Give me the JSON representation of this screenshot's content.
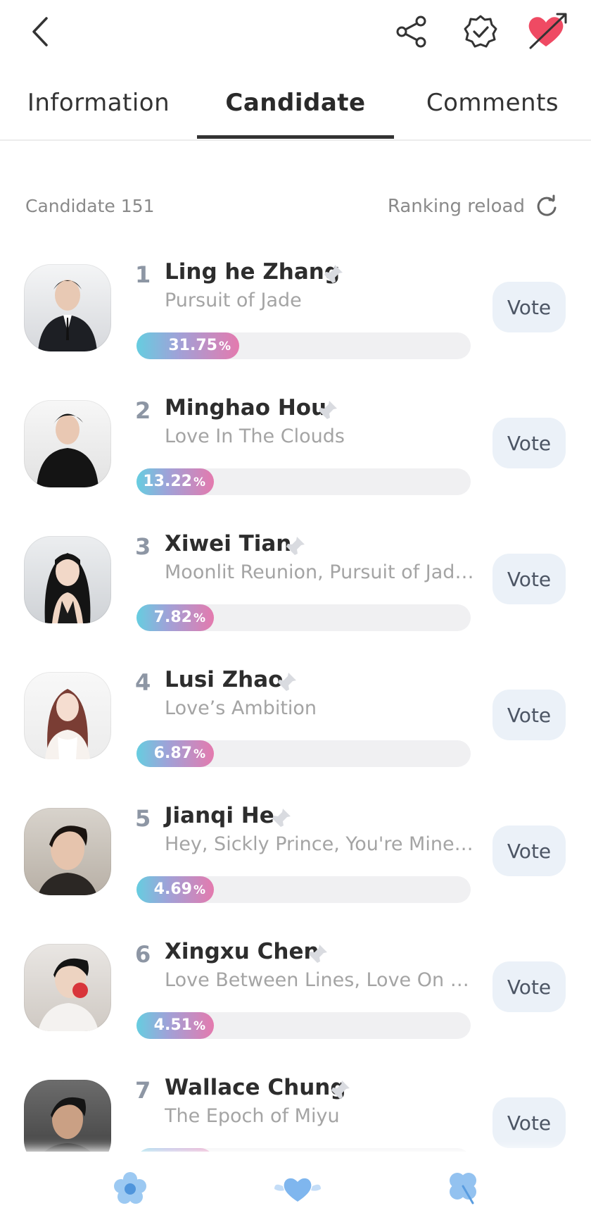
{
  "header": {
    "icons": [
      "back-arrow-icon",
      "share-icon",
      "verified-badge-icon",
      "heart-arrow-icon"
    ],
    "colors": {
      "heart": "#ef4a63",
      "icon": "#333333"
    }
  },
  "tabs": [
    {
      "label": "Information",
      "active": false
    },
    {
      "label": "Candidate",
      "active": true
    },
    {
      "label": "Comments",
      "active": false
    }
  ],
  "summary": {
    "count_label": "Candidate 151",
    "reload_label": "Ranking reload"
  },
  "vote_label": "Vote",
  "percent_sign": "%",
  "candidates": [
    {
      "rank": "1",
      "name": "Ling he Zhang",
      "work": "Pursuit of Jade",
      "percent": "31.75",
      "share": 0.3175
    },
    {
      "rank": "2",
      "name": "Minghao Hou",
      "work": "Love In The Clouds",
      "percent": "13.22",
      "share": 0.1322
    },
    {
      "rank": "3",
      "name": "Xiwei Tian",
      "work": "Moonlit Reunion, Pursuit of Jade...",
      "percent": "7.82",
      "share": 0.0782
    },
    {
      "rank": "4",
      "name": "Lusi Zhao",
      "work": "Love’s Ambition",
      "percent": "6.87",
      "share": 0.0687
    },
    {
      "rank": "5",
      "name": "Jianqi He",
      "work": "Hey, Sickly Prince, You're Mine t...",
      "percent": "4.69",
      "share": 0.0469
    },
    {
      "rank": "6",
      "name": "Xingxu Chen",
      "work": "Love Between Lines, Love On Th...",
      "percent": "4.51",
      "share": 0.0451
    },
    {
      "rank": "7",
      "name": "Wallace Chung",
      "work": "The Epoch of Miyu",
      "percent": "",
      "share": 0.04
    }
  ],
  "bottom_nav": [
    "flower-icon",
    "heart-wings-icon",
    "clover-icon"
  ]
}
